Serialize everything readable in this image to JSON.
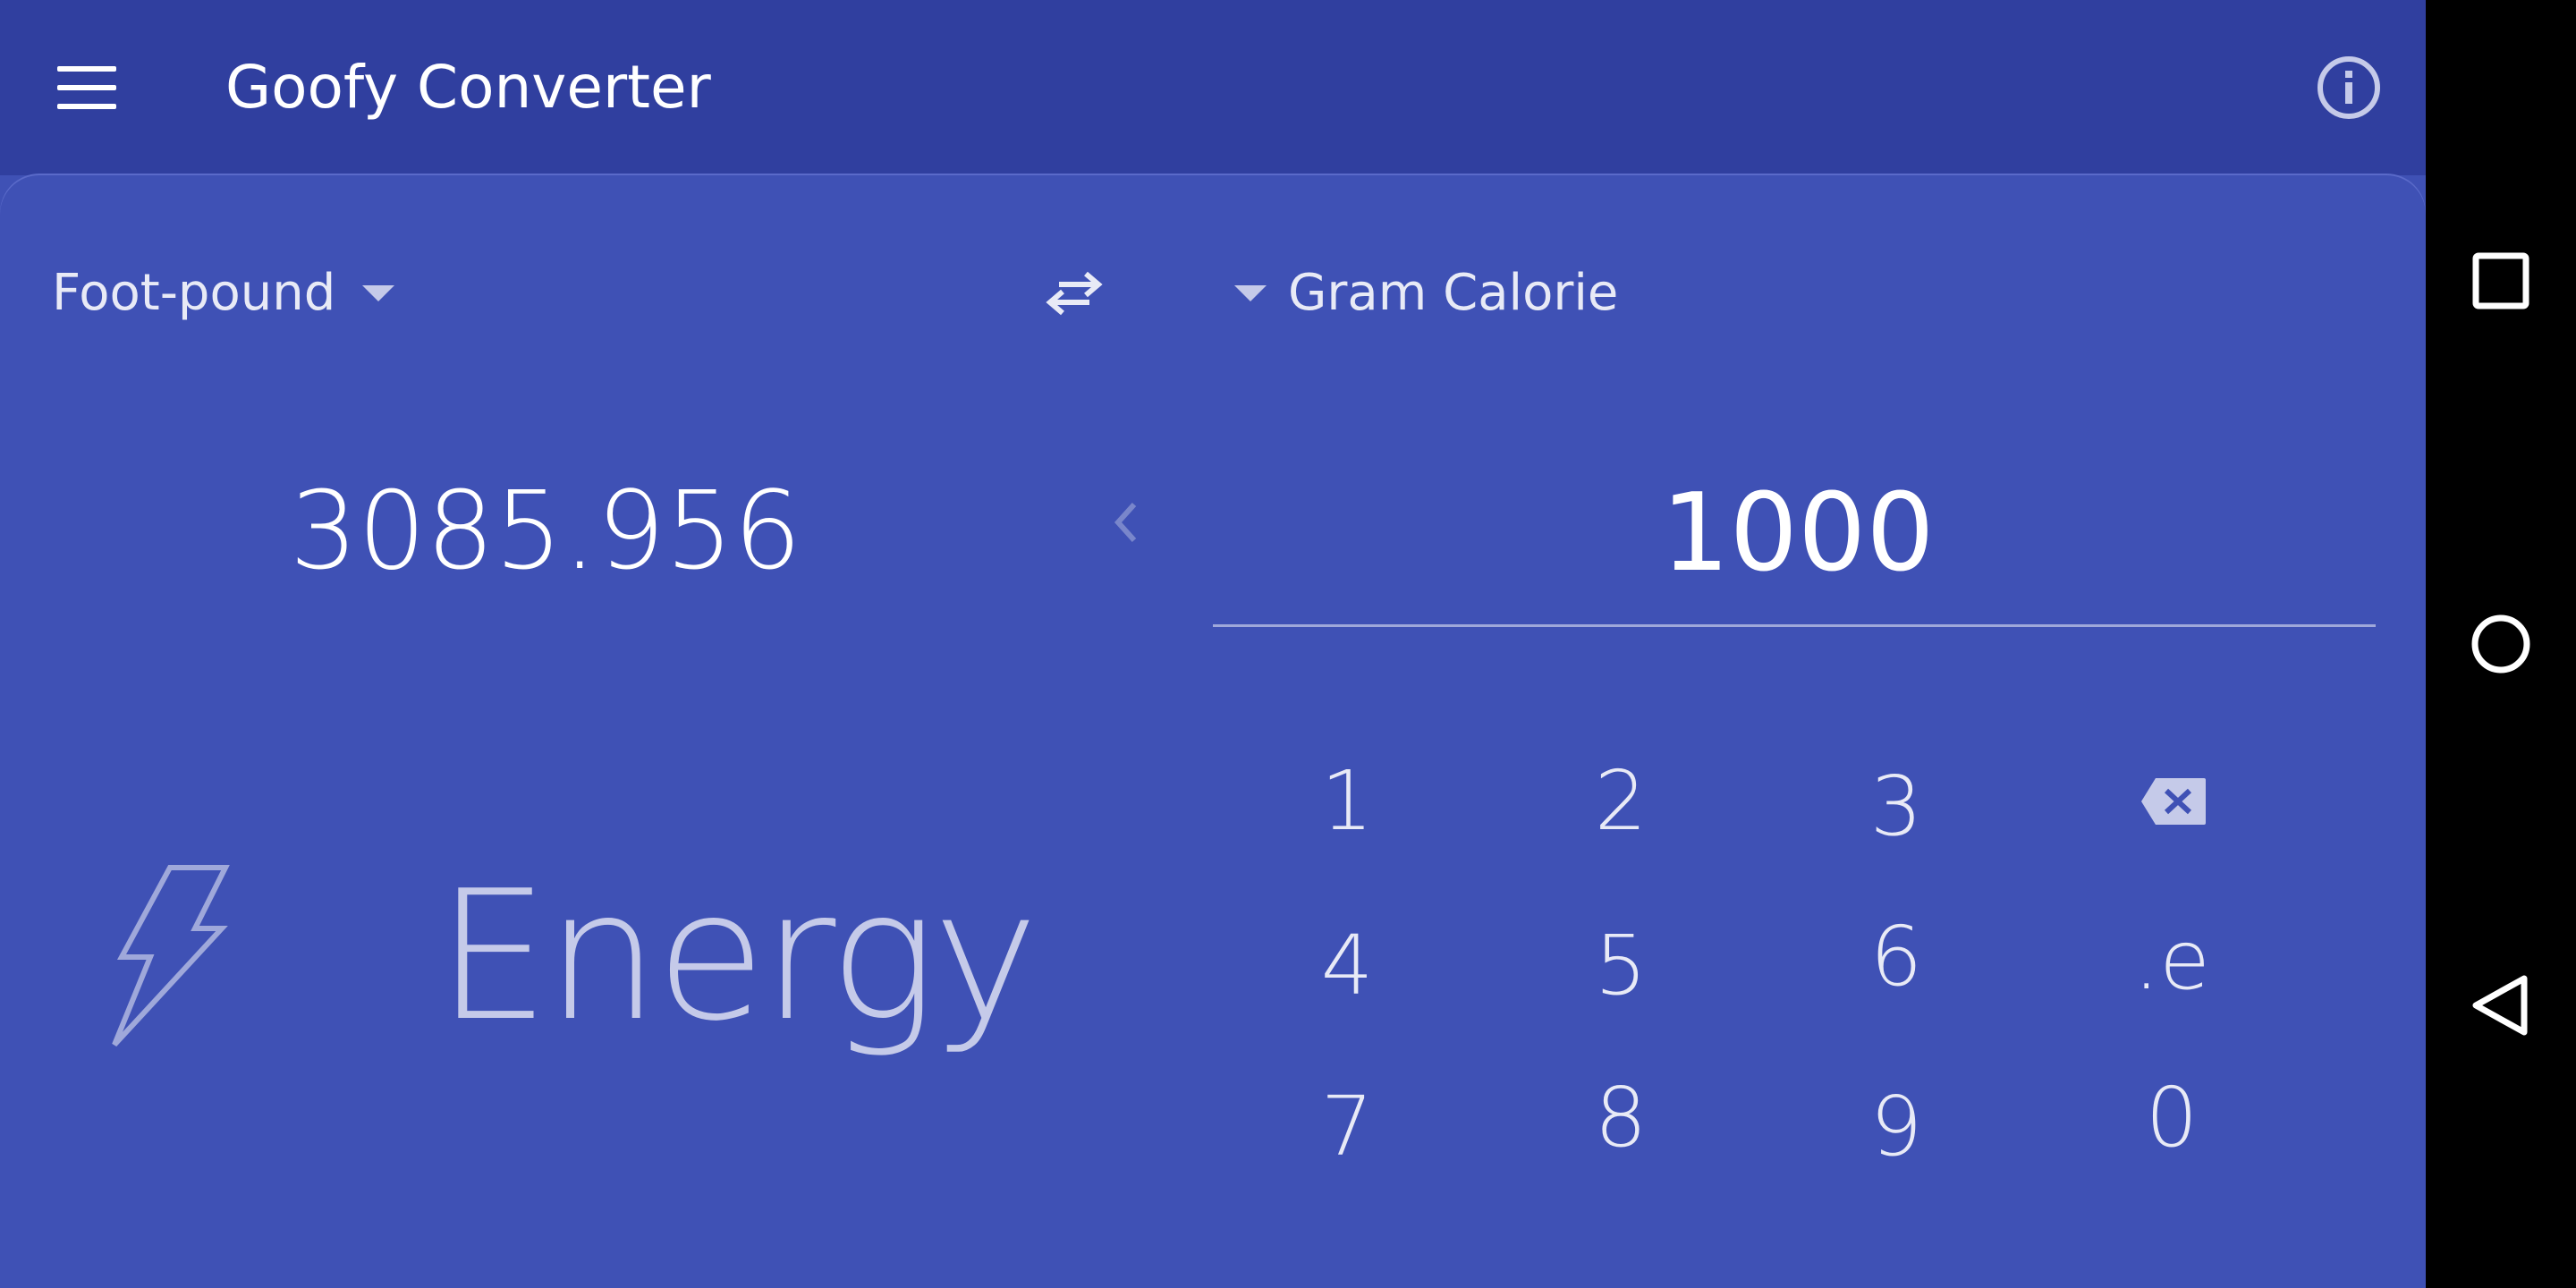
{
  "app": {
    "title": "Goofy Converter",
    "menu_icon": "menu-icon",
    "info_icon": "info-icon"
  },
  "converter": {
    "from_unit": "Foot-pound",
    "to_unit": "Gram Calorie",
    "swap_icon": "swap-arrows-icon",
    "from_value": "3085.956",
    "to_value": "1000",
    "back_icon": "chevron-left-icon"
  },
  "category": {
    "label": "Energy",
    "icon": "lightning-bolt-icon"
  },
  "keypad": {
    "keys": [
      "1",
      "2",
      "3",
      "",
      "4",
      "5",
      "6",
      ".e",
      "7",
      "8",
      "9",
      "0"
    ],
    "backspace_icon": "backspace-icon"
  },
  "system_nav": {
    "icons": [
      "recents-square-icon",
      "home-circle-icon",
      "back-triangle-icon"
    ]
  },
  "colors": {
    "primary": "#3f51b5",
    "primary_dark": "#303f9f",
    "text": "#ffffff",
    "text_muted": "#c5cae9"
  }
}
